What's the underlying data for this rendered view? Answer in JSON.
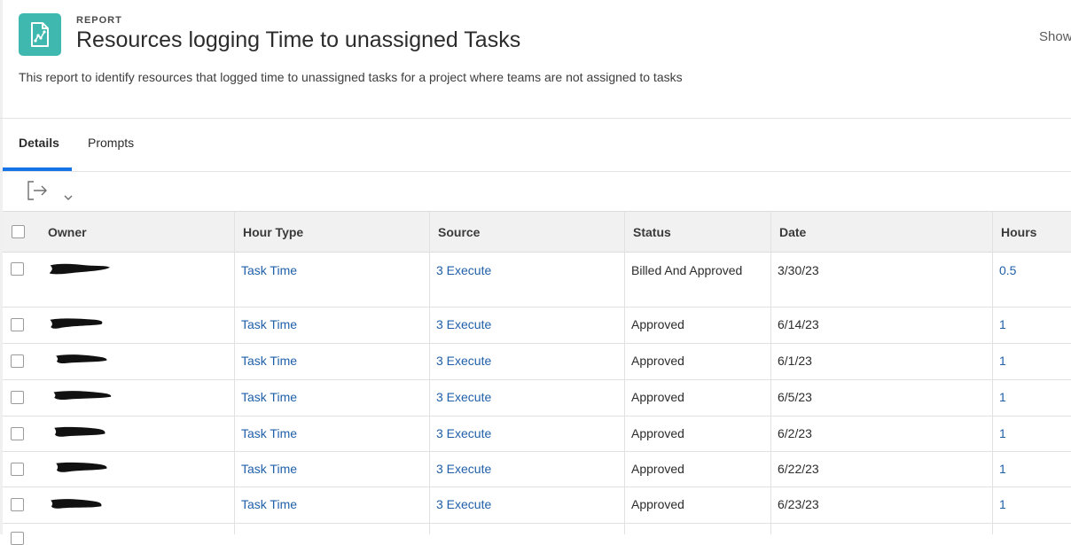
{
  "header": {
    "eyebrow": "REPORT",
    "title": "Resources logging Time to unassigned Tasks",
    "show_label": "Show",
    "description": "This report to identify resources that logged time to unassigned tasks for a project where teams are not assigned to tasks",
    "icon": "report-chart-icon",
    "icon_color": "#3fb8b0"
  },
  "tabs": [
    {
      "label": "Details",
      "active": true
    },
    {
      "label": "Prompts",
      "active": false
    }
  ],
  "toolbar": {
    "export_icon": "export-icon",
    "dropdown_icon": "chevron-down-icon"
  },
  "table": {
    "columns": [
      "Owner",
      "Hour Type",
      "Source",
      "Status",
      "Date",
      "Hours"
    ],
    "rows": [
      {
        "owner": "",
        "hour_type": "Task Time",
        "source": "3 Execute",
        "status": "Billed And Approved",
        "date": "3/30/23",
        "hours": "0.5"
      },
      {
        "owner": "",
        "hour_type": "Task Time",
        "source": "3 Execute",
        "status": "Approved",
        "date": "6/14/23",
        "hours": "1"
      },
      {
        "owner": "",
        "hour_type": "Task Time",
        "source": "3 Execute",
        "status": "Approved",
        "date": "6/1/23",
        "hours": "1"
      },
      {
        "owner": "",
        "hour_type": "Task Time",
        "source": "3 Execute",
        "status": "Approved",
        "date": "6/5/23",
        "hours": "1"
      },
      {
        "owner": "",
        "hour_type": "Task Time",
        "source": "3 Execute",
        "status": "Approved",
        "date": "6/2/23",
        "hours": "1"
      },
      {
        "owner": "",
        "hour_type": "Task Time",
        "source": "3 Execute",
        "status": "Approved",
        "date": "6/22/23",
        "hours": "1"
      },
      {
        "owner": "",
        "hour_type": "Task Time",
        "source": "3 Execute",
        "status": "Approved",
        "date": "6/23/23",
        "hours": "1"
      }
    ]
  },
  "colors": {
    "link": "#1f5fa8",
    "accent": "#1473e6",
    "header_bg": "#f1f1f1"
  }
}
